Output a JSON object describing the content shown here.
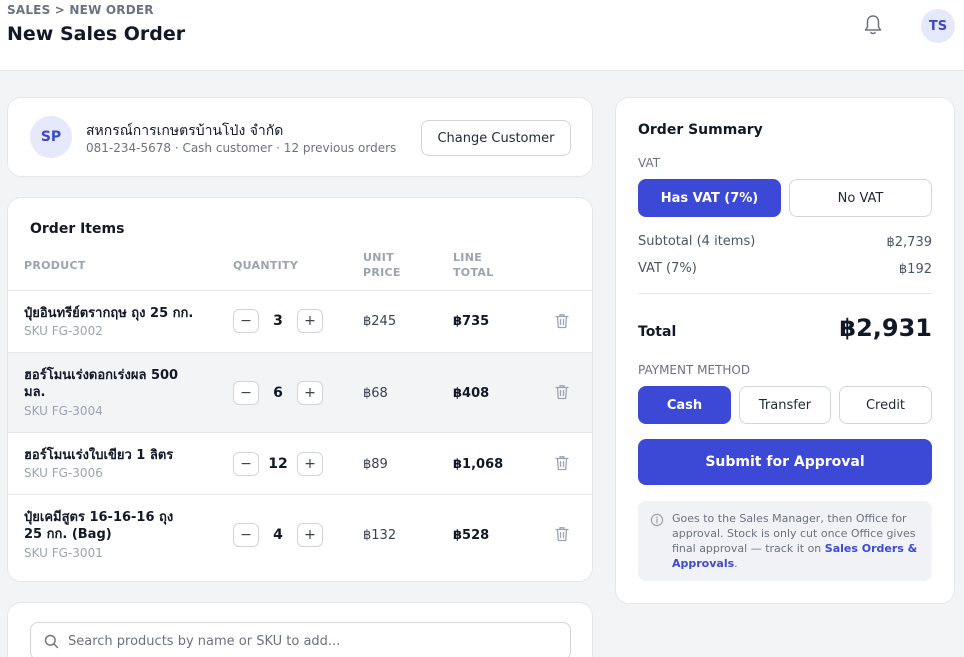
{
  "header": {
    "breadcrumb": "SALES > NEW ORDER",
    "title": "New Sales Order",
    "user_initials": "TS"
  },
  "customer": {
    "initials": "SP",
    "name": "สหกรณ์การเกษตรบ้านโป่ง จำกัด",
    "meta": "081-234-5678 · Cash customer · 12 previous orders",
    "change_label": "Change Customer"
  },
  "order_items": {
    "title": "Order Items",
    "columns": {
      "product": "PRODUCT",
      "quantity": "QUANTITY",
      "unit_price_1": "UNIT",
      "unit_price_2": "PRICE",
      "line_total_1": "LINE",
      "line_total_2": "TOTAL"
    },
    "rows": [
      {
        "name": "ปุ๋ยอินทรีย์ตรากฤษ ถุง 25 กก.",
        "sku": "SKU FG-3002",
        "qty": "3",
        "unit_price": "฿245",
        "line_total": "฿735"
      },
      {
        "name": "ฮอร์โมนเร่งดอกเร่งผล 500 มล.",
        "sku": "SKU FG-3004",
        "qty": "6",
        "unit_price": "฿68",
        "line_total": "฿408"
      },
      {
        "name": "ฮอร์โมนเร่งใบเขียว 1 ลิตร",
        "sku": "SKU FG-3006",
        "qty": "12",
        "unit_price": "฿89",
        "line_total": "฿1,068"
      },
      {
        "name": "ปุ๋ยเคมีสูตร 16-16-16 ถุง 25 กก. (Bag)",
        "sku": "SKU FG-3001",
        "qty": "4",
        "unit_price": "฿132",
        "line_total": "฿528"
      }
    ],
    "minus": "−",
    "plus": "+"
  },
  "search": {
    "placeholder": "Search products by name or SKU to add..."
  },
  "summary": {
    "title": "Order Summary",
    "vat_label": "VAT",
    "vat_on": "Has VAT (7%)",
    "vat_off": "No VAT",
    "subtotal_label": "Subtotal (4 items)",
    "subtotal_value": "฿2,739",
    "vat_line_label": "VAT (7%)",
    "vat_line_value": "฿192",
    "total_label": "Total",
    "total_value": "฿2,931",
    "payment_label": "PAYMENT METHOD",
    "payment_options": [
      "Cash",
      "Transfer",
      "Credit"
    ],
    "submit_label": "Submit for Approval",
    "note_text": "Goes to the Sales Manager, then Office for approval. Stock is only cut once Office gives final approval — track it on ",
    "note_link": "Sales Orders & Approvals",
    "note_end": "."
  },
  "colors": {
    "accent": "#3b49d6",
    "accent_light": "#e6e9fb"
  },
  "icons": [
    "bell-icon",
    "trash-icon",
    "search-icon",
    "info-icon"
  ]
}
